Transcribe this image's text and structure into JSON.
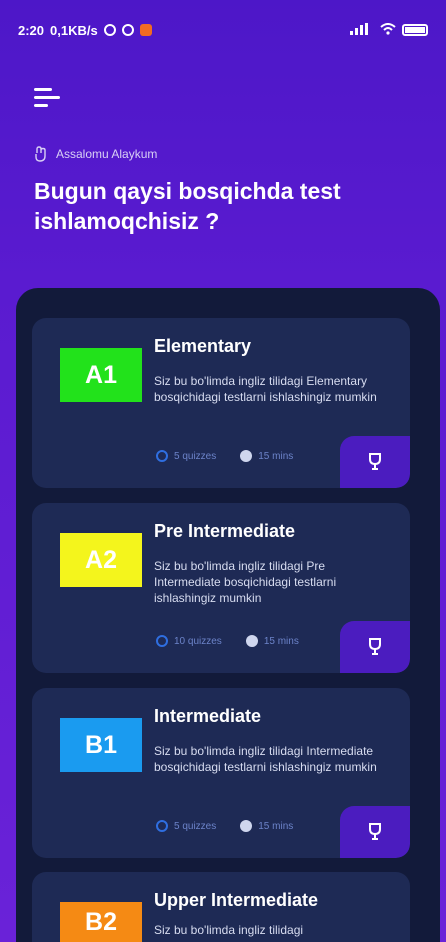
{
  "status_bar": {
    "time": "2:20",
    "speed": "0,1KB/s",
    "right_icons": "signal-wifi-battery"
  },
  "greeting": "Assalomu Alaykum",
  "headline": "Bugun qaysi bosqichda test ishlamoqchisiz ?",
  "colors": {
    "background": "#5a1bd0",
    "panel": "#121a3a",
    "card": "#1e2a55",
    "trophy_button": "#4b1cbf"
  },
  "levels": [
    {
      "code": "A1",
      "title": "Elementary",
      "description": "Siz bu bo'limda ingliz tilidagi Elementary bosqichidagi testlarni ishlashingiz mumkin",
      "quizzes": "5 quizzes",
      "minutes": "15 mins",
      "color": "#22e21b"
    },
    {
      "code": "A2",
      "title": "Pre Intermediate",
      "description": "Siz bu bo'limda ingliz tilidagi Pre Intermediate bosqichidagi testlarni ishlashingiz mumkin",
      "quizzes": "10 quizzes",
      "minutes": "15 mins",
      "color": "#f4f51c"
    },
    {
      "code": "B1",
      "title": "Intermediate",
      "description": "Siz bu bo'limda ingliz tilidagi Intermediate bosqichidagi testlarni ishlashingiz mumkin",
      "quizzes": "5 quizzes",
      "minutes": "15 mins",
      "color": "#1a9bf0"
    },
    {
      "code": "B2",
      "title": "Upper Intermediate",
      "description": "Siz bu bo'limda ingliz tilidagi",
      "quizzes": "",
      "minutes": "",
      "color": "#f58a14"
    }
  ]
}
